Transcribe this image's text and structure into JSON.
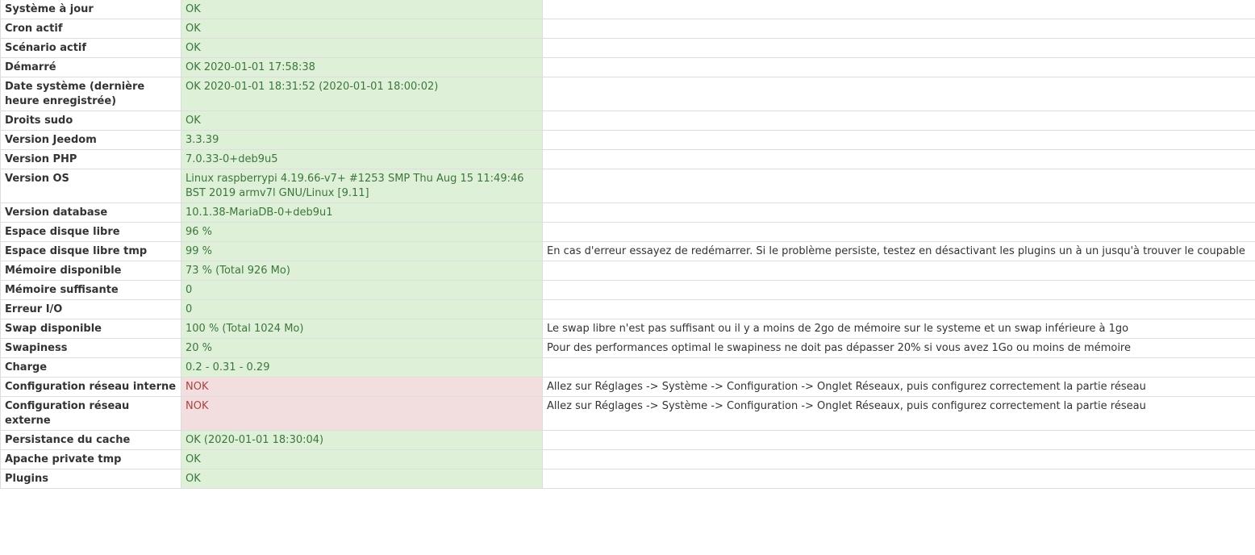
{
  "colors": {
    "ok_background": "#dff0d8",
    "ok_text": "#3c763d",
    "nok_background": "#f2dede",
    "nok_text": "#a94442",
    "border": "#dddddd"
  },
  "rows": [
    {
      "id": "systeme-a-jour",
      "label": "Système à jour",
      "state": "OK",
      "status": "ok",
      "advice": ""
    },
    {
      "id": "cron-actif",
      "label": "Cron actif",
      "state": "OK",
      "status": "ok",
      "advice": ""
    },
    {
      "id": "scenario-actif",
      "label": "Scénario actif",
      "state": "OK",
      "status": "ok",
      "advice": ""
    },
    {
      "id": "demarre",
      "label": "Démarré",
      "state": "OK 2020-01-01 17:58:38",
      "status": "ok",
      "advice": ""
    },
    {
      "id": "date-systeme",
      "label": "Date système (dernière heure enregistrée)",
      "state": "OK 2020-01-01 18:31:52 (2020-01-01 18:00:02)",
      "status": "ok",
      "advice": ""
    },
    {
      "id": "droits-sudo",
      "label": "Droits sudo",
      "state": "OK",
      "status": "ok",
      "advice": ""
    },
    {
      "id": "version-jeedom",
      "label": "Version Jeedom",
      "state": "3.3.39",
      "status": "ok",
      "advice": ""
    },
    {
      "id": "version-php",
      "label": "Version PHP",
      "state": "7.0.33-0+deb9u5",
      "status": "ok",
      "advice": ""
    },
    {
      "id": "version-os",
      "label": "Version OS",
      "state": "Linux raspberrypi 4.19.66-v7+ #1253 SMP Thu Aug 15 11:49:46 BST 2019 armv7l GNU/Linux [9.11]",
      "status": "ok",
      "advice": ""
    },
    {
      "id": "version-database",
      "label": "Version database",
      "state": "10.1.38-MariaDB-0+deb9u1",
      "status": "ok",
      "advice": ""
    },
    {
      "id": "espace-disque-libre",
      "label": "Espace disque libre",
      "state": "96 %",
      "status": "ok",
      "advice": ""
    },
    {
      "id": "espace-disque-libre-tmp",
      "label": "Espace disque libre tmp",
      "state": "99 %",
      "status": "ok",
      "advice": "En cas d'erreur essayez de redémarrer. Si le problème persiste, testez en désactivant les plugins un à un jusqu'à trouver le coupable"
    },
    {
      "id": "memoire-disponible",
      "label": "Mémoire disponible",
      "state": "73 % (Total 926 Mo)",
      "status": "ok",
      "advice": ""
    },
    {
      "id": "memoire-suffisante",
      "label": "Mémoire suffisante",
      "state": "0",
      "status": "ok",
      "advice": ""
    },
    {
      "id": "erreur-io",
      "label": "Erreur I/O",
      "state": "0",
      "status": "ok",
      "advice": ""
    },
    {
      "id": "swap-disponible",
      "label": "Swap disponible",
      "state": "100 % (Total 1024 Mo)",
      "status": "ok",
      "advice": "Le swap libre n'est pas suffisant ou il y a moins de 2go de mémoire sur le systeme et un swap inférieure à 1go"
    },
    {
      "id": "swapiness",
      "label": "Swapiness",
      "state": "20 %",
      "status": "ok",
      "advice": "Pour des performances optimal le swapiness ne doit pas dépasser 20% si vous avez 1Go ou moins de mémoire"
    },
    {
      "id": "charge",
      "label": "Charge",
      "state": "0.2 - 0.31 - 0.29",
      "status": "ok",
      "advice": ""
    },
    {
      "id": "config-reseau-interne",
      "label": "Configuration réseau interne",
      "state": "NOK",
      "status": "nok",
      "advice": "Allez sur Réglages -> Système -> Configuration -> Onglet Réseaux, puis configurez correctement la partie réseau"
    },
    {
      "id": "config-reseau-externe",
      "label": "Configuration réseau externe",
      "state": "NOK",
      "status": "nok",
      "advice": "Allez sur Réglages -> Système -> Configuration -> Onglet Réseaux, puis configurez correctement la partie réseau"
    },
    {
      "id": "persistance-cache",
      "label": "Persistance du cache",
      "state": "OK (2020-01-01 18:30:04)",
      "status": "ok",
      "advice": ""
    },
    {
      "id": "apache-private-tmp",
      "label": "Apache private tmp",
      "state": "OK",
      "status": "ok",
      "advice": ""
    },
    {
      "id": "plugins",
      "label": "Plugins",
      "state": "OK",
      "status": "ok",
      "advice": ""
    }
  ]
}
